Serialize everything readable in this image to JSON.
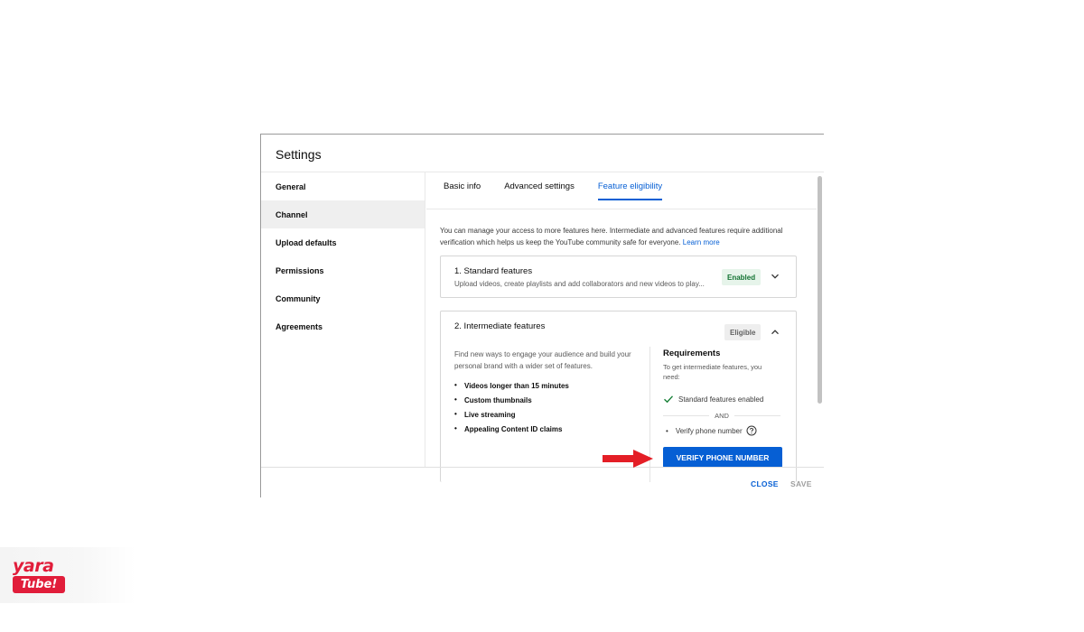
{
  "dialog": {
    "title": "Settings",
    "sidebar": {
      "items": [
        {
          "label": "General"
        },
        {
          "label": "Channel"
        },
        {
          "label": "Upload defaults"
        },
        {
          "label": "Permissions"
        },
        {
          "label": "Community"
        },
        {
          "label": "Agreements"
        }
      ],
      "active": "Channel"
    },
    "tabs": [
      {
        "label": "Basic info"
      },
      {
        "label": "Advanced settings"
      },
      {
        "label": "Feature eligibility"
      }
    ],
    "active_tab": "Feature eligibility",
    "intro": {
      "text": "You can manage your access to more features here. Intermediate and advanced features require additional verification which helps us keep the YouTube community safe for everyone.",
      "link": "Learn more"
    },
    "standard": {
      "title": "1. Standard features",
      "subtitle": "Upload videos, create playlists and add collaborators and new videos to play...",
      "badge": "Enabled"
    },
    "intermediate": {
      "title": "2. Intermediate features",
      "badge": "Eligible",
      "description": "Find new ways to engage your audience and build your personal brand with a wider set of features.",
      "features": [
        "Videos longer than 15 minutes",
        "Custom thumbnails",
        "Live streaming",
        "Appealing Content ID claims"
      ],
      "requirements": {
        "title": "Requirements",
        "description": "To get intermediate features, you need:",
        "met": "Standard features enabled",
        "and": "AND",
        "pending": "Verify phone number"
      },
      "verify_button": "VERIFY PHONE NUMBER"
    },
    "footer": {
      "close": "CLOSE",
      "save": "SAVE"
    }
  },
  "watermark": {
    "top": "yara",
    "badge": "Tube!"
  },
  "colors": {
    "accent": "#065fd4",
    "enabled_bg": "#e6f4ea",
    "enabled_text": "#137333",
    "arrow": "#e41e26",
    "brand": "#e11d3a"
  }
}
